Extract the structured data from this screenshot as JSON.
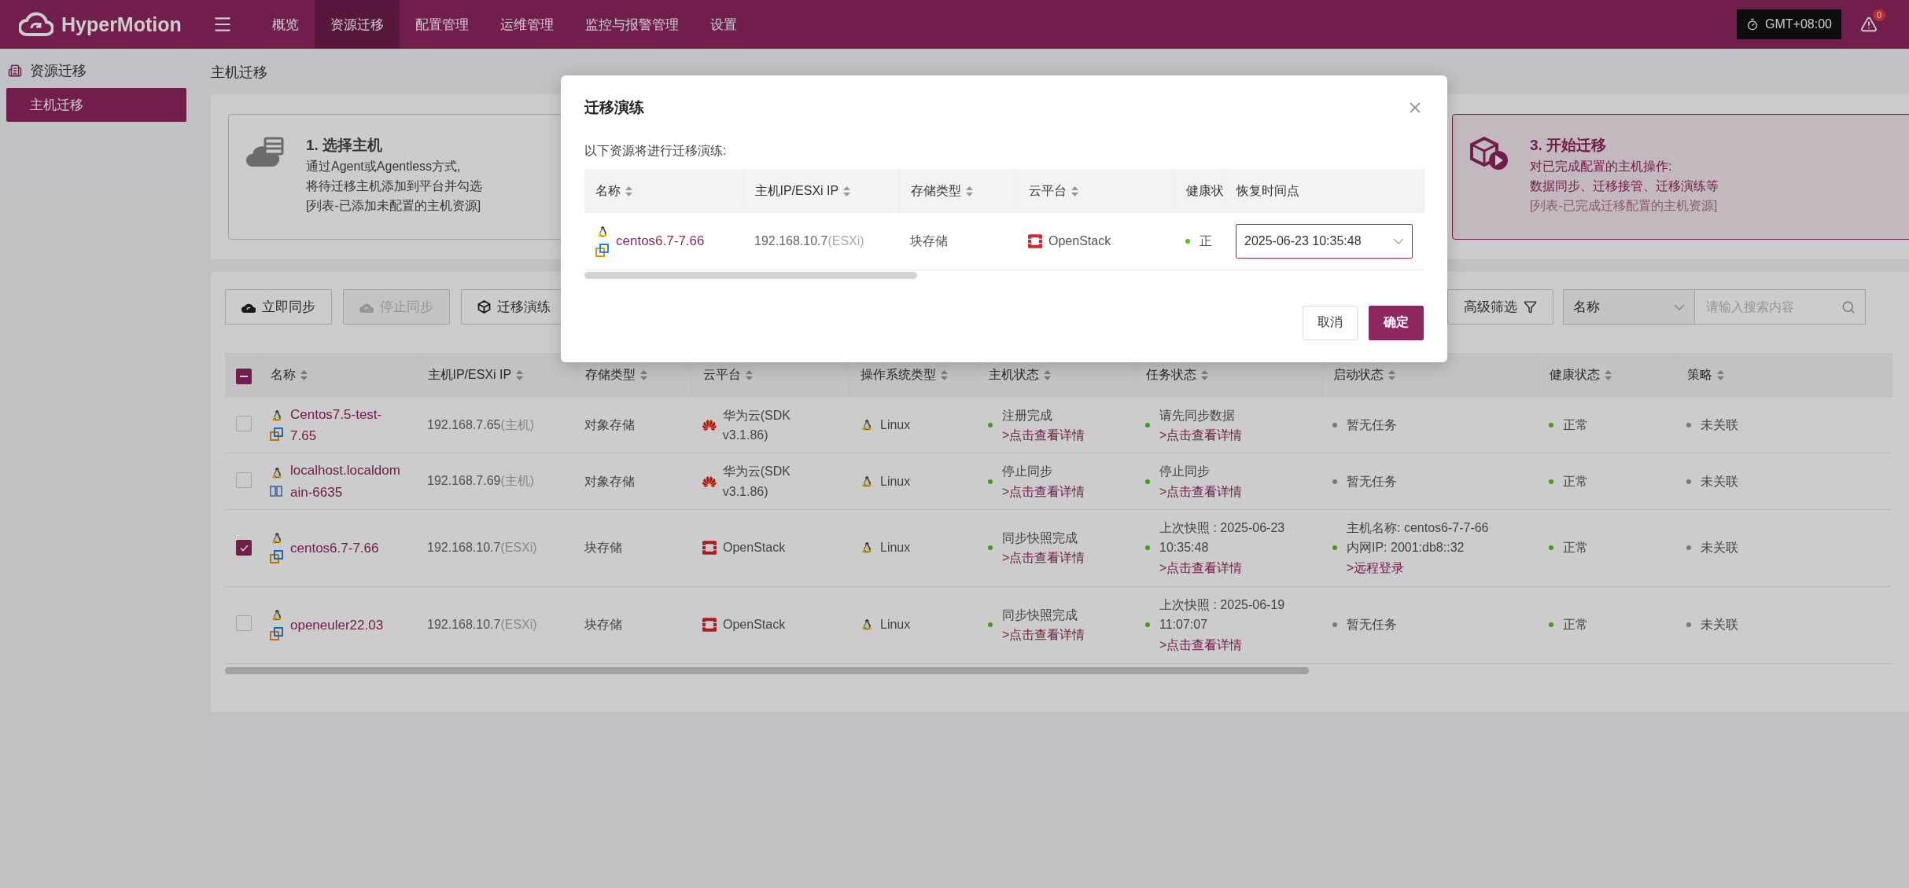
{
  "header": {
    "brand": "HyperMotion",
    "nav": [
      {
        "label": "概览",
        "selected": false
      },
      {
        "label": "资源迁移",
        "selected": true
      },
      {
        "label": "配置管理",
        "selected": false
      },
      {
        "label": "运维管理",
        "selected": false
      },
      {
        "label": "监控与报警管理",
        "selected": false
      },
      {
        "label": "设置",
        "selected": false
      }
    ],
    "timezone": "GMT+08:00",
    "alert_count": "0"
  },
  "sidebar": {
    "group": "资源迁移",
    "items": [
      {
        "label": "主机迁移",
        "selected": true
      }
    ]
  },
  "page_title": "主机迁移",
  "steps": [
    {
      "kind": "select",
      "title": "1. 选择主机",
      "lines": [
        "通过Agent或Agentless方式,",
        "将待迁移主机添加到平台并勾选"
      ],
      "note": "[列表-已添加未配置的主机资源]",
      "selected": false
    },
    {
      "kind": "start",
      "title": "3. 开始迁移",
      "lines": [
        "对已完成配置的主机操作:",
        "数据同步、迁移接管、迁移演练等"
      ],
      "note": "[列表-已完成迁移配置的主机资源]",
      "selected": true
    }
  ],
  "toolbar": {
    "buttons": [
      {
        "label": "立即同步",
        "disabled": false
      },
      {
        "label": "停止同步",
        "disabled": true
      },
      {
        "label": "迁移演练",
        "disabled": false
      }
    ],
    "filter_button": "高级筛选",
    "search_by": "名称",
    "search": {
      "placeholder": "请输入搜索内容"
    }
  },
  "table": {
    "indeterminate": true,
    "columns": [
      "名称",
      "主机IP/ESXi IP",
      "存储类型",
      "云平台",
      "操作系统类型",
      "主机状态",
      "任务状态",
      "启动状态",
      "健康状态",
      "策略"
    ],
    "rows": [
      {
        "checked": false,
        "name": {
          "kind": "vm",
          "text": "Centos7.5-test-7.65"
        },
        "ip": "192.168.7.65",
        "ip_type": "(主机)",
        "storage": "对象存储",
        "cloud": {
          "kind": "huawei",
          "text": "华为云(SDK v3.1.86)"
        },
        "os": "Linux",
        "host_state": {
          "lines": [
            "注册完成"
          ],
          "link": ">点击查看详情",
          "color": "#429d15"
        },
        "task_state": {
          "lines": [
            "请先同步数据"
          ],
          "link": ">点击查看详情",
          "color": "#429d15"
        },
        "boot_state": {
          "lines": [
            "暂无任务"
          ],
          "color": "#7a7a7a"
        },
        "health": {
          "text": "正常",
          "color": "#429d15"
        },
        "policy": {
          "text": "未关联",
          "color": "#7a7a7a"
        }
      },
      {
        "checked": false,
        "name": {
          "kind": "server",
          "text": "localhost.localdomain-6635"
        },
        "ip": "192.168.7.69",
        "ip_type": "(主机)",
        "storage": "对象存储",
        "cloud": {
          "kind": "huawei",
          "text": "华为云(SDK v3.1.86)"
        },
        "os": "Linux",
        "host_state": {
          "lines": [
            "停止同步"
          ],
          "link": ">点击查看详情",
          "color": "#429d15"
        },
        "task_state": {
          "lines": [
            "停止同步"
          ],
          "link": ">点击查看详情",
          "color": "#429d15"
        },
        "boot_state": {
          "lines": [
            "暂无任务"
          ],
          "color": "#7a7a7a"
        },
        "health": {
          "text": "正常",
          "color": "#429d15"
        },
        "policy": {
          "text": "未关联",
          "color": "#7a7a7a"
        }
      },
      {
        "checked": true,
        "name": {
          "kind": "vm",
          "text": "centos6.7-7.66"
        },
        "ip": "192.168.10.7",
        "ip_type": "(ESXi)",
        "storage": "块存储",
        "cloud": {
          "kind": "openstack",
          "text": "OpenStack"
        },
        "os": "Linux",
        "host_state": {
          "lines": [
            "同步快照完成"
          ],
          "link": ">点击查看详情",
          "color": "#429d15"
        },
        "task_state": {
          "lines": [
            "上次快照 : 2025-06-23 10:35:48"
          ],
          "link": ">点击查看详情",
          "color": "#429d15"
        },
        "boot_state": {
          "lines": [
            "主机名称: centos6-7-7-66",
            "内网IP: 2001:db8::32"
          ],
          "link": ">远程登录",
          "color": "#429d15"
        },
        "health": {
          "text": "正常",
          "color": "#429d15"
        },
        "policy": {
          "text": "未关联",
          "color": "#7a7a7a"
        }
      },
      {
        "checked": false,
        "name": {
          "kind": "vm",
          "text": "openeuler22.03"
        },
        "ip": "192.168.10.7",
        "ip_type": "(ESXi)",
        "storage": "块存储",
        "cloud": {
          "kind": "openstack",
          "text": "OpenStack"
        },
        "os": "Linux",
        "host_state": {
          "lines": [
            "同步快照完成"
          ],
          "link": ">点击查看详情",
          "color": "#429d15"
        },
        "task_state": {
          "lines": [
            "上次快照 : 2025-06-19 11:07:07"
          ],
          "link": ">点击查看详情",
          "color": "#429d15"
        },
        "boot_state": {
          "lines": [
            "暂无任务"
          ],
          "color": "#7a7a7a"
        },
        "health": {
          "text": "正常",
          "color": "#429d15"
        },
        "policy": {
          "text": "未关联",
          "color": "#7a7a7a"
        }
      }
    ]
  },
  "modal": {
    "title": "迁移演练",
    "intro": "以下资源将进行迁移演练:",
    "columns": [
      "名称",
      "主机IP/ESXi IP",
      "存储类型",
      "云平台",
      "健康状"
    ],
    "fixed_column": "恢复时间点",
    "rows": [
      {
        "name": {
          "kind": "vm",
          "text": "centos6.7-7.66"
        },
        "ip": "192.168.10.7",
        "ip_type": "(ESXi)",
        "storage": "块存储",
        "cloud": {
          "kind": "openstack",
          "text": "OpenStack"
        },
        "health": {
          "text": "正",
          "color": "#52c41a"
        },
        "restore_point": "2025-06-23 10:35:48"
      }
    ],
    "cancel": "取消",
    "confirm": "确定"
  }
}
